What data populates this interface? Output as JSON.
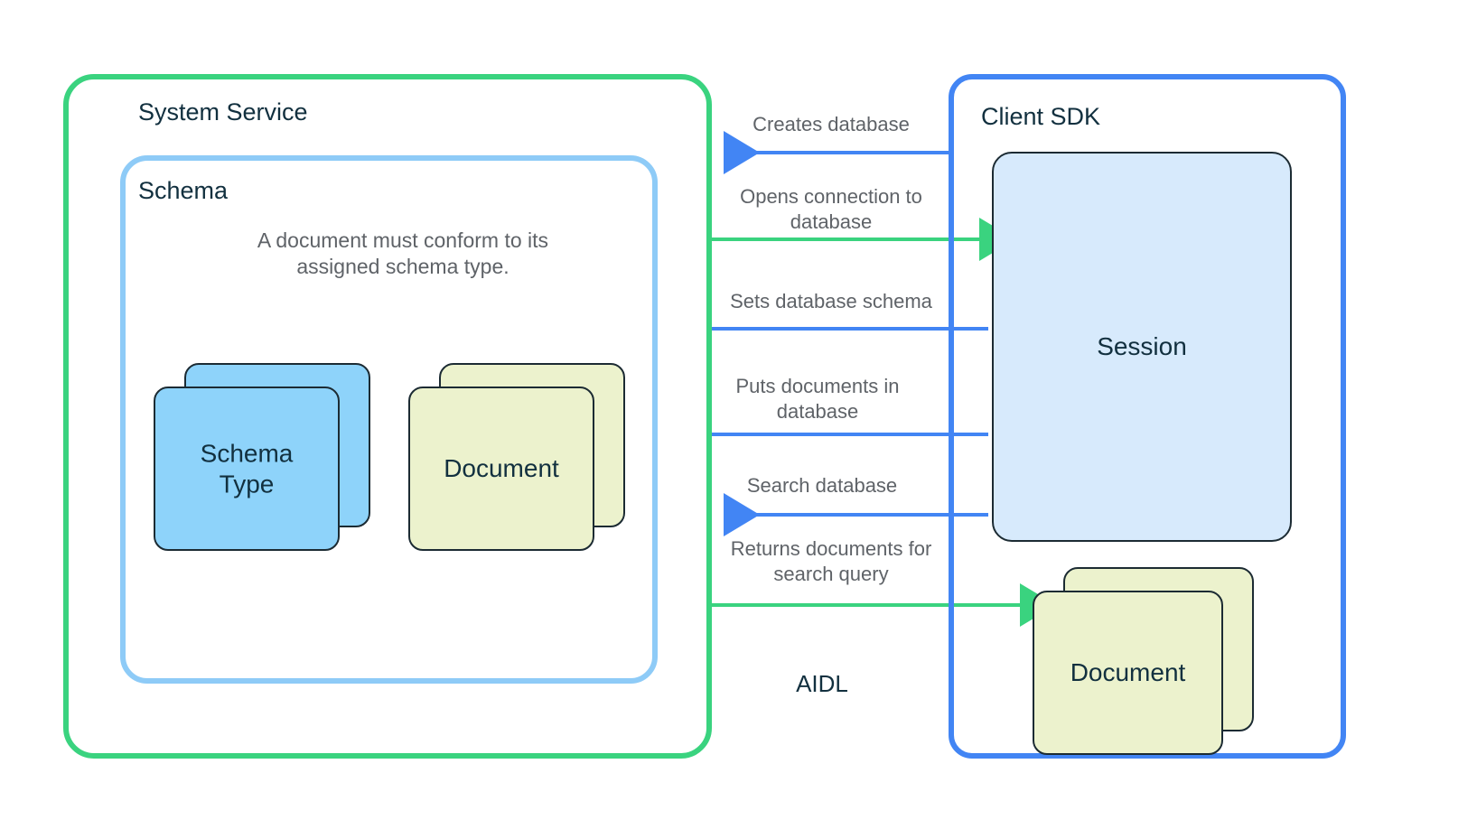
{
  "regions": {
    "system_service": {
      "title": "System Service",
      "border_color": "#3ad37f"
    },
    "schema": {
      "title": "Schema",
      "border_color": "#8ecbf7",
      "note": "A document must conform to its assigned schema type."
    },
    "client_sdk": {
      "title": "Client SDK",
      "border_color": "#4285f4"
    }
  },
  "nodes": {
    "schema_type": {
      "label": "Schema\nType",
      "fill": "#8ed3fa",
      "stacked": true
    },
    "document_schema": {
      "label": "Document",
      "fill": "#ecf2cd",
      "stacked": true
    },
    "session": {
      "label": "Session",
      "fill": "#d7eafc",
      "stacked": false
    },
    "document_client": {
      "label": "Document",
      "fill": "#ecf2cd",
      "stacked": true
    }
  },
  "conform_arrow": {
    "description": "curved arrow from Document to Schema Type",
    "color": "#5f6368"
  },
  "aidl_boundary_label": "AIDL",
  "flows": [
    {
      "label": "Creates database",
      "direction": "right-to-left",
      "color": "#4285f4"
    },
    {
      "label": "Opens connection to database",
      "direction": "left-to-right",
      "color": "#3ad37f"
    },
    {
      "label": "Sets database schema",
      "direction": "right-to-left",
      "color": "#4285f4"
    },
    {
      "label": "Puts documents in database",
      "direction": "right-to-left",
      "color": "#4285f4"
    },
    {
      "label": "Search database",
      "direction": "right-to-left",
      "color": "#4285f4"
    },
    {
      "label": "Returns documents for search query",
      "direction": "left-to-right",
      "color": "#3ad37f"
    }
  ]
}
